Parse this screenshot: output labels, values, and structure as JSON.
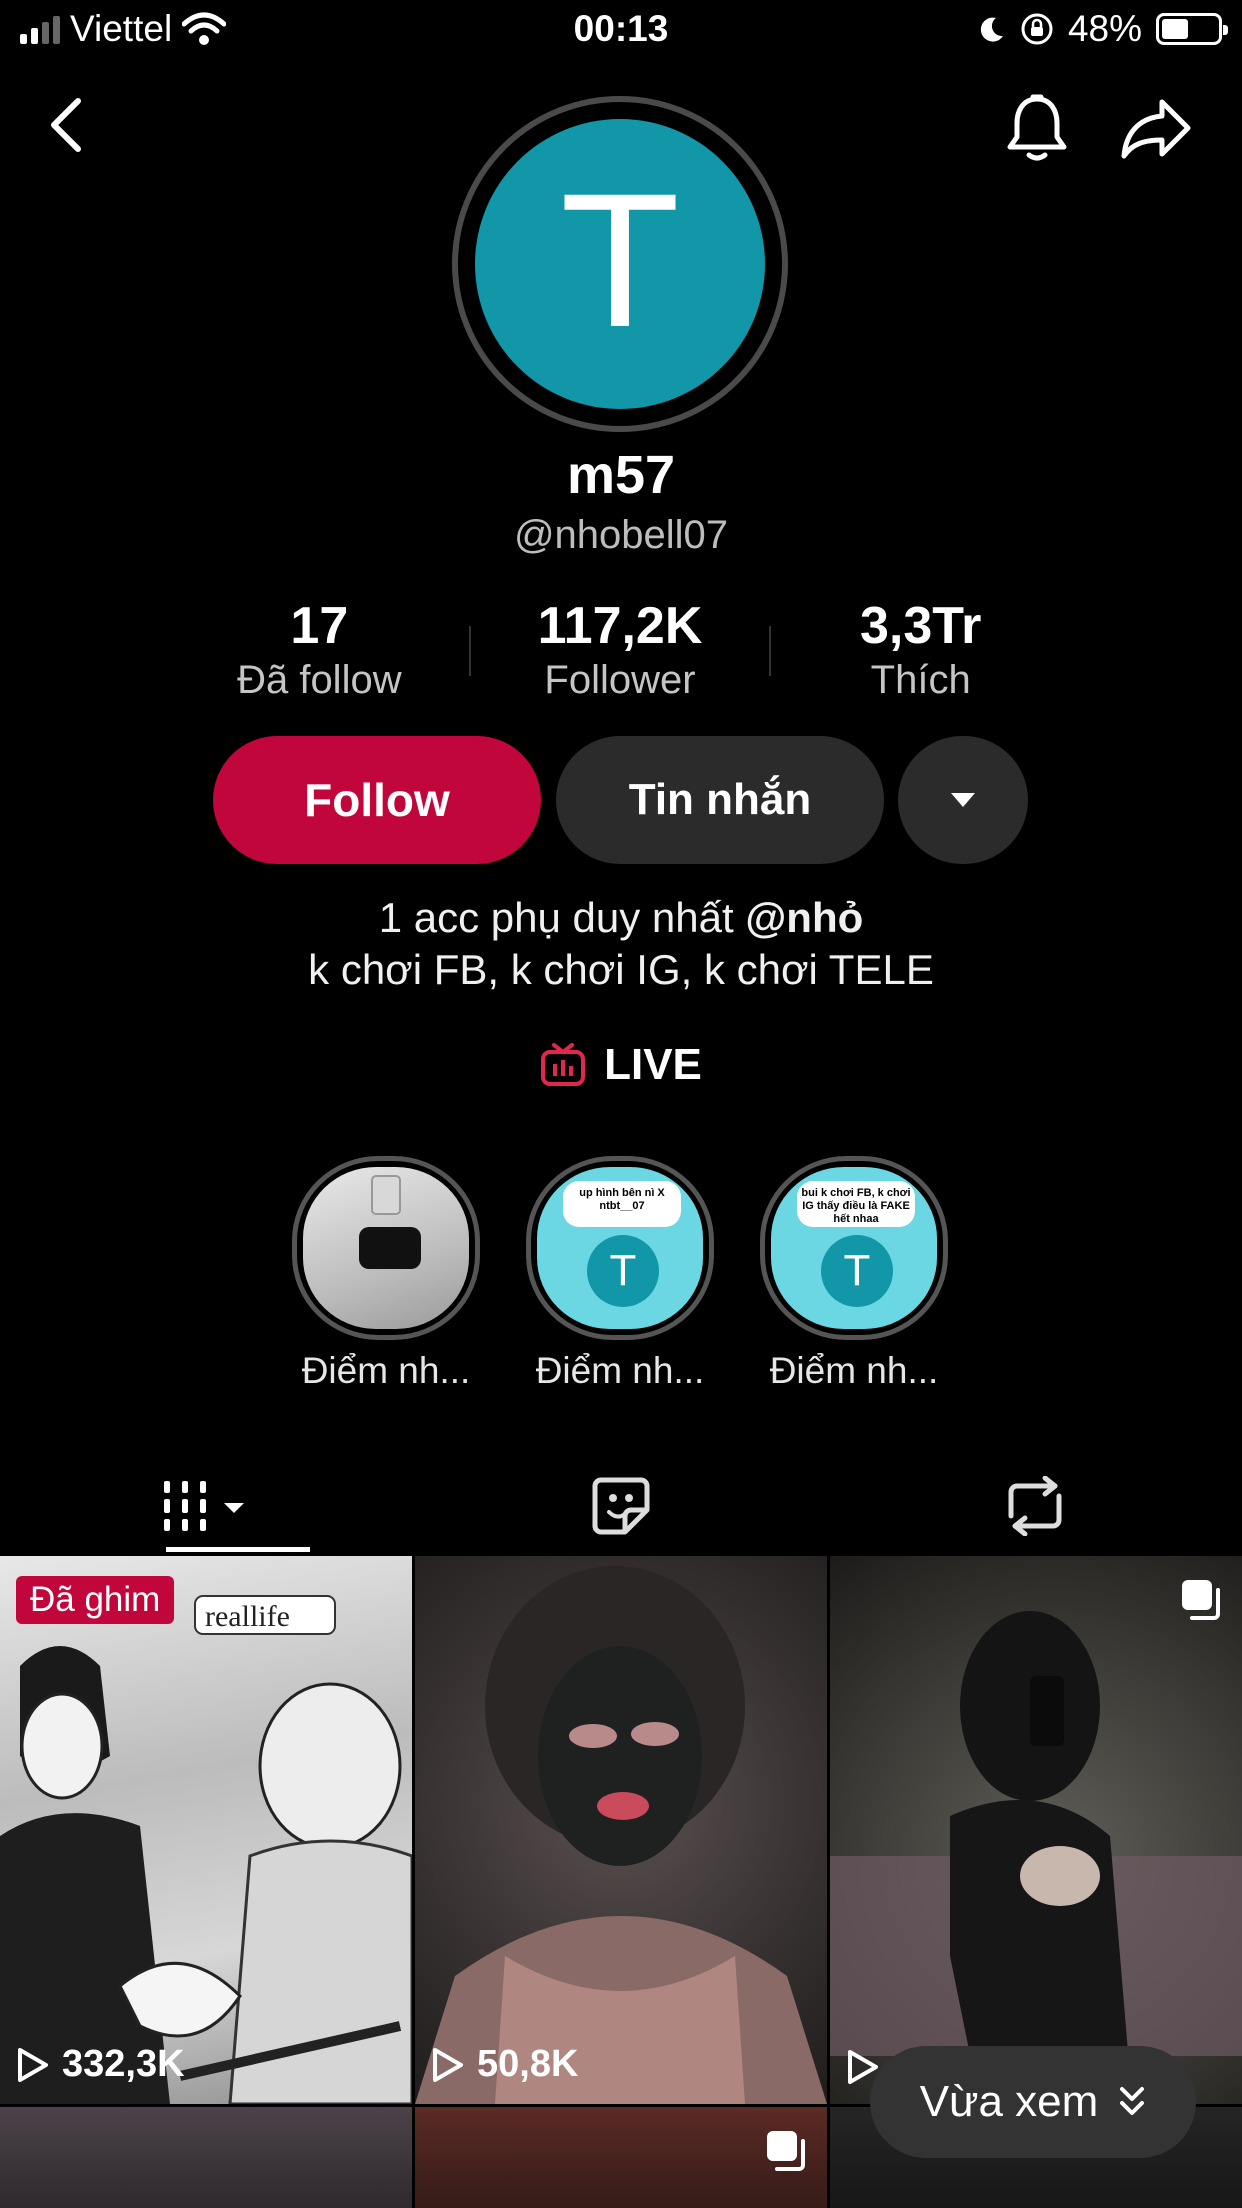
{
  "status_bar": {
    "carrier": "Viettel",
    "time": "00:13",
    "battery": "48%",
    "battery_level": 0.48
  },
  "profile": {
    "avatar_letter": "T",
    "display_name": "m57",
    "handle": "@nhobell07",
    "avatar_color": "#1297a8"
  },
  "stats": [
    {
      "value": "17",
      "label": "Đã follow"
    },
    {
      "value": "117,2K",
      "label": "Follower"
    },
    {
      "value": "3,3Tr",
      "label": "Thích"
    }
  ],
  "actions": {
    "follow_label": "Follow",
    "message_label": "Tin nhắn",
    "follow_color": "#c0063b"
  },
  "bio": {
    "line1_prefix": "1 acc phụ duy nhất ",
    "line1_mention": "@nhỏ",
    "line2": "k chơi FB, k chơi IG, k chơi TELE"
  },
  "live_label": "LIVE",
  "highlights": [
    {
      "label": "Điểm nh...",
      "bubble": ""
    },
    {
      "label": "Điểm nh...",
      "bubble": "up hình bên nì X ntbt__07",
      "letter": "T"
    },
    {
      "label": "Điểm nh...",
      "bubble": "bui k chơi FB, k chơi IG thấy điều là FAKE hết nhaa",
      "letter": "T"
    }
  ],
  "tabs": [
    "videos-tab",
    "favorites-tab",
    "reposts-tab"
  ],
  "videos": [
    {
      "pinned": "Đã ghim",
      "views": "332,3K"
    },
    {
      "pinned": "",
      "views": "50,8K"
    },
    {
      "pinned": "",
      "views": ""
    }
  ],
  "recent_button": "Vừa xem"
}
